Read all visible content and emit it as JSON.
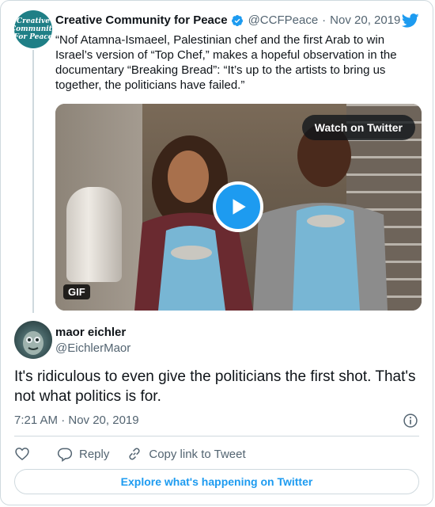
{
  "quoted_tweet": {
    "avatar_text": "Creative Community For Peace",
    "author_name": "Creative Community for Peace",
    "author_handle": "@CCFPeace",
    "separator": "·",
    "date": "Nov 20, 2019",
    "text": "“Nof Atamna-Ismaeel, Palestinian chef and the first Arab to win Israel’s version of “Top Chef,” makes a hopeful observation in the documentary “Breaking Bread”: “It’s up to the artists to bring us together, the politicians have failed.”",
    "media": {
      "watch_label": "Watch on Twitter",
      "badge": "GIF"
    }
  },
  "reply_tweet": {
    "author_name": "maor eichler",
    "author_handle": "@EichlerMaor",
    "text": "It's ridiculous to even give the politicians the first shot. That's not what politics is for.",
    "time": "7:21 AM · Nov 20, 2019"
  },
  "actions": {
    "reply_label": "Reply",
    "copy_label": "Copy link to Tweet"
  },
  "explore_label": "Explore what's happening on Twitter",
  "icons": [
    "twitter-bird-icon",
    "verified-badge-icon",
    "play-icon",
    "info-icon",
    "heart-icon",
    "reply-icon",
    "link-icon"
  ],
  "colors": {
    "accent": "#1d9bf0",
    "text": "#0f1419",
    "secondary": "#536471",
    "border": "#cfd9de"
  }
}
